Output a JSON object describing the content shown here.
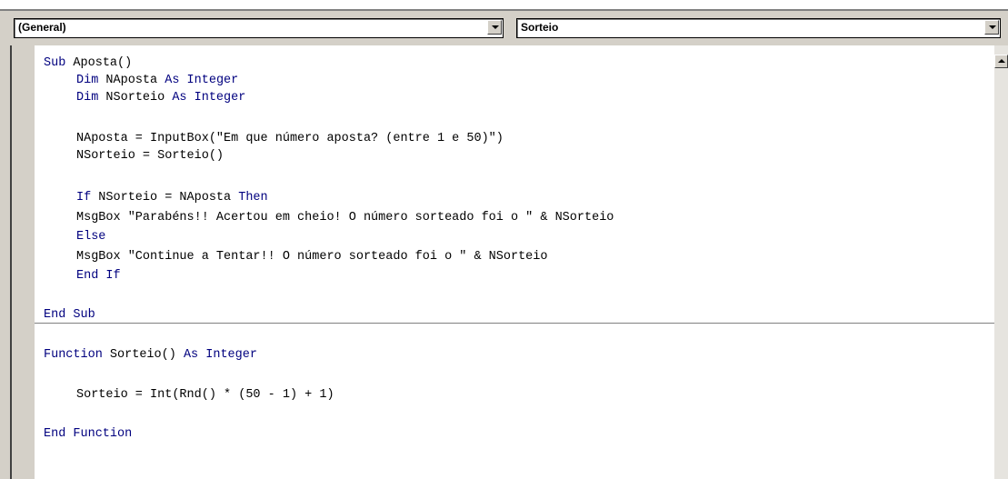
{
  "object_combo": {
    "value": "(General)"
  },
  "procedure_combo": {
    "value": "Sorteio"
  },
  "code": {
    "l1_kw": "Sub",
    "l1_rest": " Aposta()",
    "l2_kw1": "Dim",
    "l2_mid": " NAposta ",
    "l2_kw2": "As Integer",
    "l3_kw1": "Dim",
    "l3_mid": " NSorteio ",
    "l3_kw2": "As Integer",
    "l4": "NAposta = InputBox(\"Em que número aposta? (entre 1 e 50)\")",
    "l5": "NSorteio = Sorteio()",
    "l6_kw1": "If",
    "l6_mid": " NSorteio = NAposta ",
    "l6_kw2": "Then",
    "l7": "MsgBox \"Parabéns!! Acertou em cheio! O número sorteado foi o \" & NSorteio",
    "l8_kw": "Else",
    "l9": "MsgBox \"Continue a Tentar!! O número sorteado foi o \" & NSorteio",
    "l10_kw": "End If",
    "l11_kw": "End Sub",
    "l12_kw1": "Function",
    "l12_mid": " Sorteio() ",
    "l12_kw2": "As Integer",
    "l13": "Sorteio = Int(Rnd() * (50 - 1) + 1)",
    "l14_kw": "End Function"
  }
}
